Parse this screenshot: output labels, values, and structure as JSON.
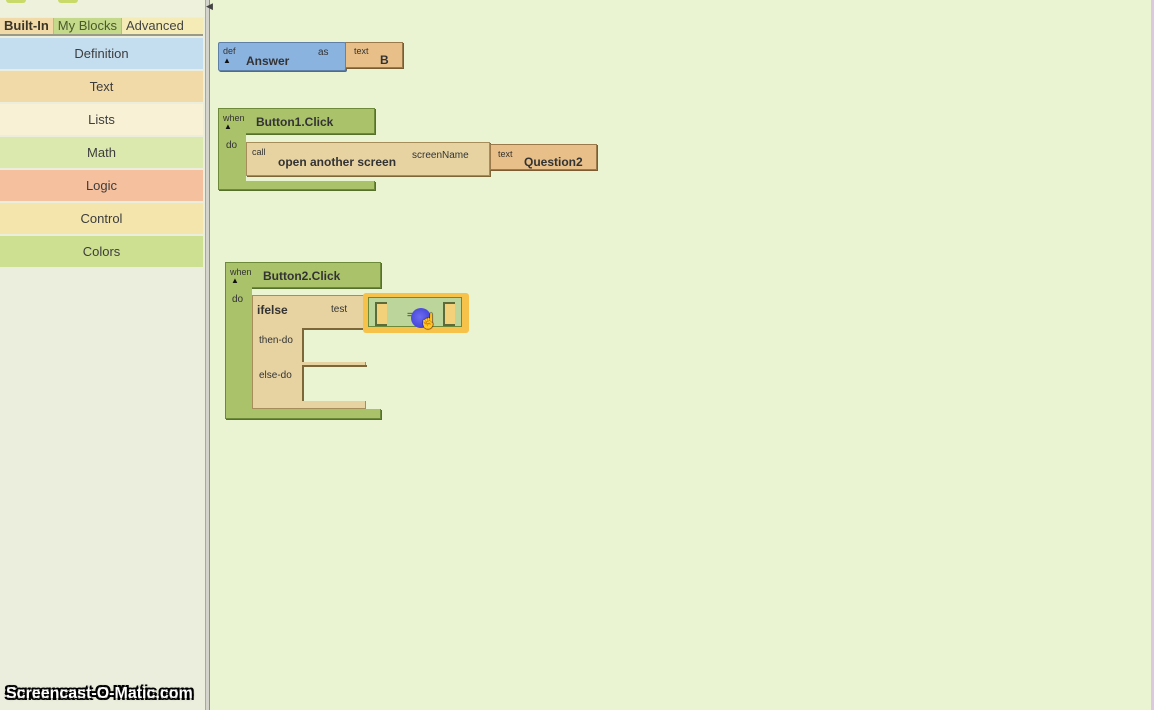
{
  "palette": {
    "tabs": [
      {
        "label": "Built-In",
        "active": true
      },
      {
        "label": "My Blocks",
        "active": false
      },
      {
        "label": "Advanced",
        "active": false
      }
    ],
    "drawers": [
      {
        "label": "Definition",
        "color": "#c4def0"
      },
      {
        "label": "Text",
        "color": "#f1d9a8"
      },
      {
        "label": "Lists",
        "color": "#f8f1d5"
      },
      {
        "label": "Math",
        "color": "#dce9ae"
      },
      {
        "label": "Logic",
        "color": "#f4c09d"
      },
      {
        "label": "Control",
        "color": "#f3e5ab"
      },
      {
        "label": "Colors",
        "color": "#cde092"
      }
    ]
  },
  "workspace": {
    "def_block": {
      "keyword": "def",
      "name": "Answer",
      "as_label": "as",
      "value": {
        "type_label": "text",
        "value": "B"
      }
    },
    "event1": {
      "when_label": "when",
      "event": "Button1.Click",
      "do_label": "do",
      "call": {
        "call_label": "call",
        "procedure": "open another screen",
        "arg_label": "screenName",
        "arg": {
          "type_label": "text",
          "value": "Question2"
        }
      }
    },
    "event2": {
      "when_label": "when",
      "event": "Button2.Click",
      "do_label": "do",
      "ifelse": {
        "name": "ifelse",
        "test_label": "test",
        "then_label": "then-do",
        "else_label": "else-do",
        "test_block": {
          "operator": "="
        }
      }
    }
  },
  "watermark": "Screencast-O-Matic.com",
  "icons": {
    "collapse_triangle": "▲",
    "splitter_arrow": "◀",
    "hand_cursor": "☝"
  }
}
